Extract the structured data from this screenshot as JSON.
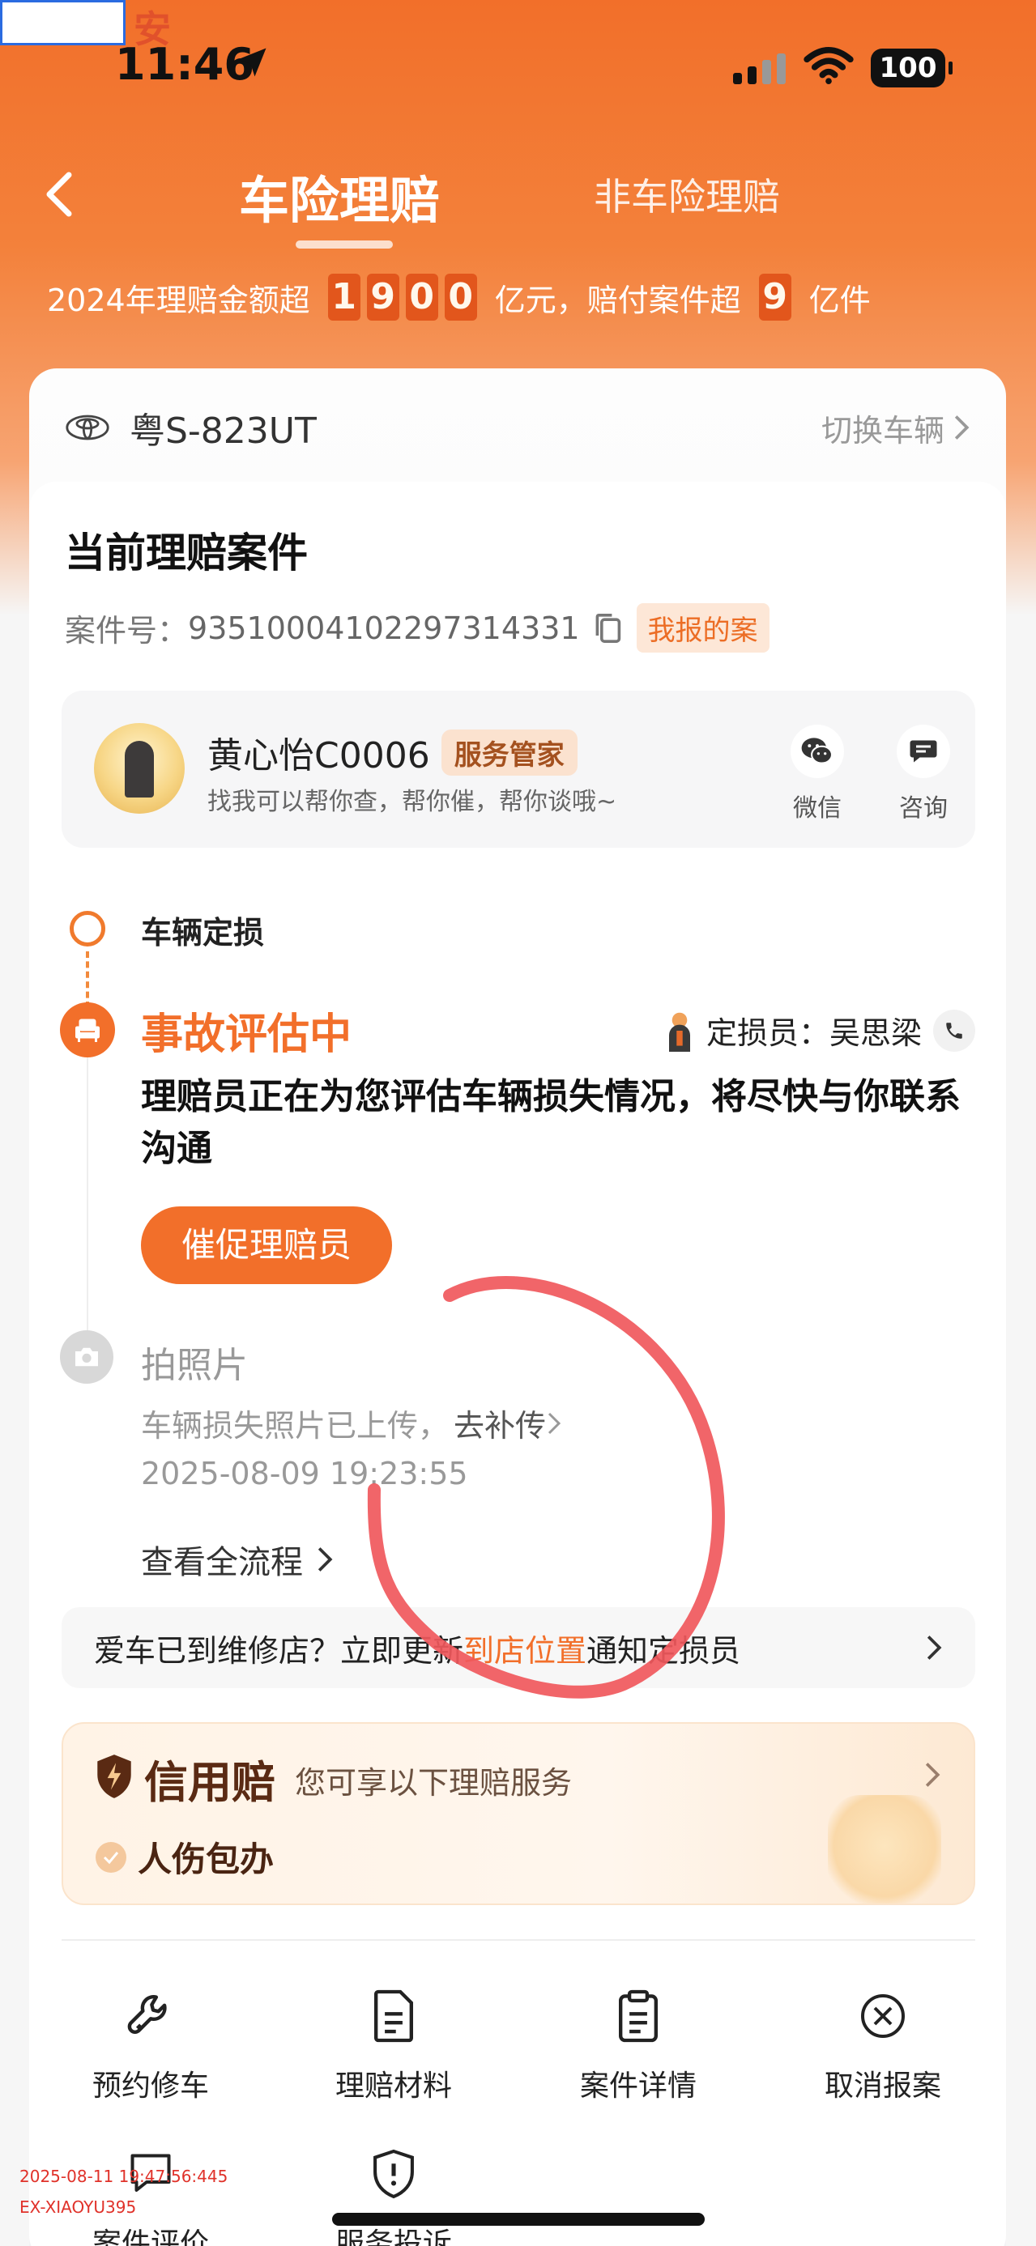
{
  "status_bar": {
    "time": "11:46",
    "battery": "100",
    "corner_text": "安"
  },
  "nav": {
    "active_tab": "车险理赔",
    "other_tab": "非车险理赔"
  },
  "stats": {
    "prefix": "2024年理赔金额超",
    "amount_digits": [
      "1",
      "9",
      "0",
      "0"
    ],
    "middle": "亿元，赔付案件超",
    "case_digit": "9",
    "suffix": "亿件"
  },
  "vehicle": {
    "plate": "粤S-823UT",
    "switch_label": "切换车辆"
  },
  "claim": {
    "title": "当前理赔案件",
    "case_label": "案件号：",
    "case_number": "93510004102297314331",
    "tag": "我报的案"
  },
  "agent": {
    "name": "黄心怡C0006",
    "badge": "服务管家",
    "subtitle": "找我可以帮你查，帮你催，帮你谈哦~",
    "wechat_label": "微信",
    "consult_label": "咨询"
  },
  "timeline": {
    "step1_label": "车辆定损",
    "active_title": "事故评估中",
    "assessor_label": "定损员：",
    "assessor_name": "吴思梁",
    "active_desc": "理赔员正在为您评估车辆损失情况，将尽快与你联系沟通",
    "urge_button": "催促理赔员",
    "photo_title": "拍照片",
    "photo_desc": "车辆损失照片已上传，",
    "photo_link": "去补传",
    "photo_time": "2025-08-09 19:23:55",
    "view_all": "查看全流程"
  },
  "repair_bar": {
    "before": "爱车已到维修店？立即更新",
    "highlight": "到店位置",
    "after": "通知定损员"
  },
  "credit": {
    "brand": "信用赔",
    "desc": "您可享以下理赔服务",
    "item": "人伤包办"
  },
  "actions": [
    {
      "label": "预约修车",
      "icon": "wrench-icon"
    },
    {
      "label": "理赔材料",
      "icon": "document-icon"
    },
    {
      "label": "案件详情",
      "icon": "clipboard-icon"
    },
    {
      "label": "取消报案",
      "icon": "cancel-circle-icon"
    },
    {
      "label": "案件评价",
      "icon": "comment-icon"
    },
    {
      "label": "服务投诉",
      "icon": "complaint-shield-icon"
    }
  ],
  "watermark": {
    "timestamp": "2025-08-11 19:47:56:445",
    "user": "EX-XIAOYU395"
  },
  "colors": {
    "accent": "#f26f2a",
    "annotation": "#f0585c"
  }
}
